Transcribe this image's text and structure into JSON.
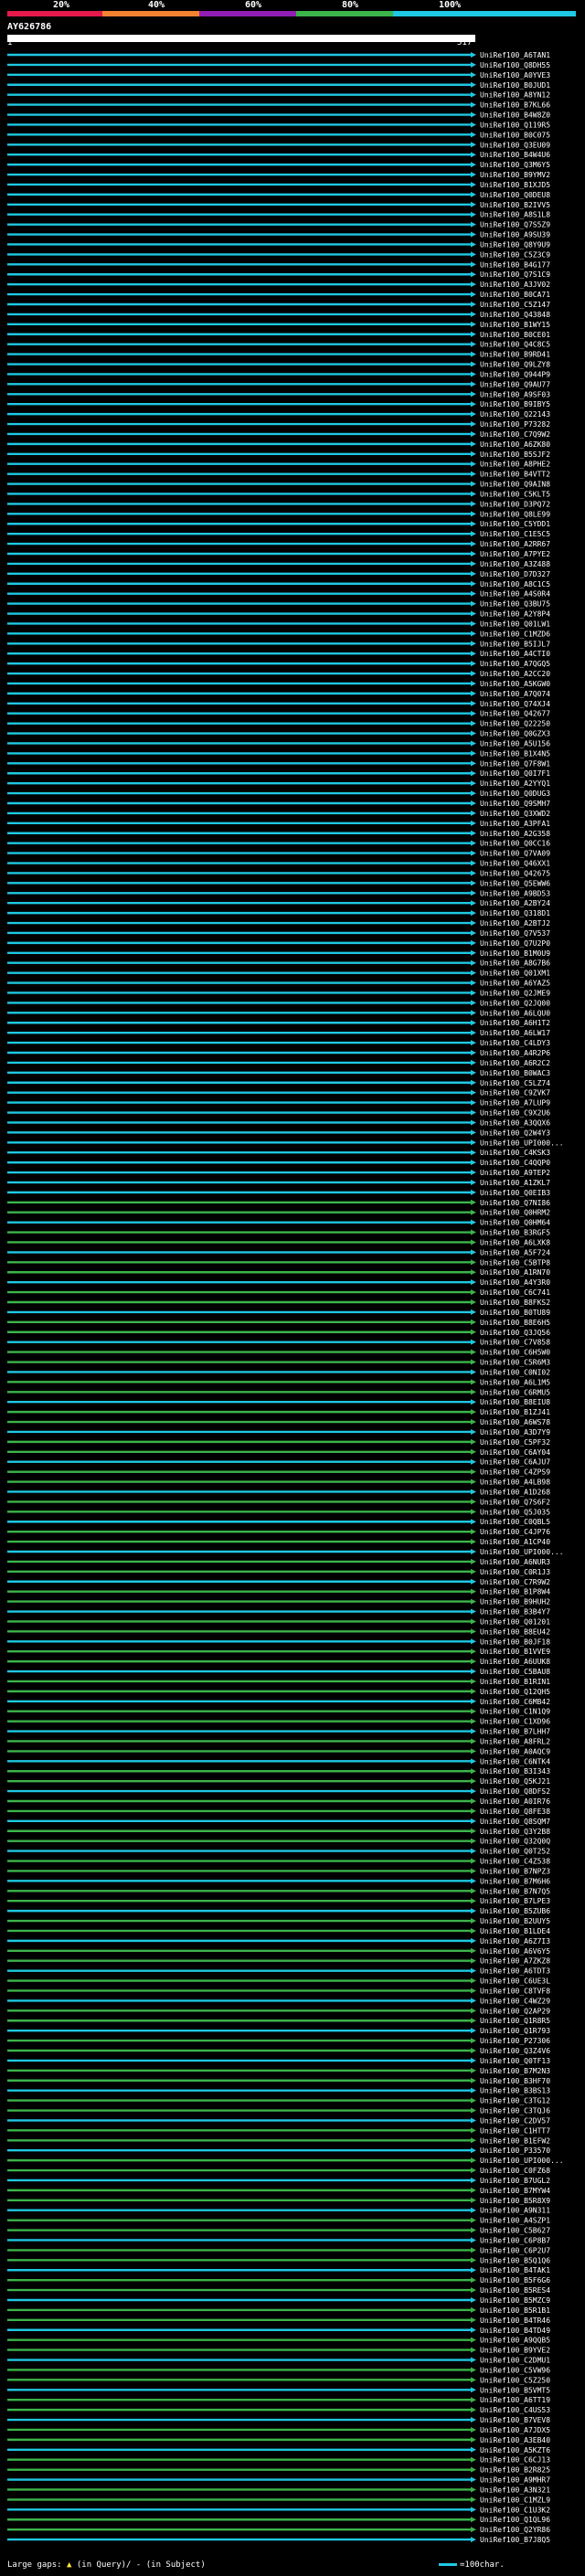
{
  "header": {
    "query_id": "AY626786",
    "query_start": "1",
    "query_end": "517",
    "percent_labels": [
      "20%",
      "40%",
      "60%",
      "80%",
      "100%"
    ],
    "band_colors": [
      "#e6194b",
      "#f58231",
      "#911eb4",
      "#3cb44b",
      "#1fc8e3"
    ]
  },
  "colors": {
    "background": "#000000",
    "hit_cyan": "#1fc8e3",
    "hit_green": "#3cb44b",
    "gap_marker": "#ffeb3b"
  },
  "hits": [
    "UniRef100_A6TAN1",
    "UniRef100_Q8DH55",
    "UniRef100_A0YVE3",
    "UniRef100_B0JUD1",
    "UniRef100_A8YN12",
    "UniRef100_B7KL66",
    "UniRef100_B4W8Z0",
    "UniRef100_Q119R5",
    "UniRef100_B0C075",
    "UniRef100_Q3EU09",
    "UniRef100_B4W4U6",
    "UniRef100_Q3M6Y5",
    "UniRef100_B9YMV2",
    "UniRef100_B1XJD5",
    "UniRef100_Q0DEU8",
    "UniRef100_B2IVV5",
    "UniRef100_A8S1L8",
    "UniRef100_Q7S5Z9",
    "UniRef100_A9SU39",
    "UniRef100_Q8Y9U9",
    "UniRef100_C5Z3C9",
    "UniRef100_B4G177",
    "UniRef100_Q7S1C9",
    "UniRef100_A3JV02",
    "UniRef100_B0CA71",
    "UniRef100_C5Z147",
    "UniRef100_Q43848",
    "UniRef100_B1WY15",
    "UniRef100_B0CE01",
    "UniRef100_Q4C8C5",
    "UniRef100_B9RD41",
    "UniRef100_Q9LZY8",
    "UniRef100_Q944P9",
    "UniRef100_Q9AU77",
    "UniRef100_A9SF03",
    "UniRef100_B9IBY5",
    "UniRef100_Q22143",
    "UniRef100_P73282",
    "UniRef100_C7Q9W2",
    "UniRef100_A6ZK80",
    "UniRef100_B5SJF2",
    "UniRef100_A8PHE2",
    "UniRef100_B4VTT2",
    "UniRef100_Q9AIN8",
    "UniRef100_C5KLT5",
    "UniRef100_D3PQ72",
    "UniRef100_Q8LE99",
    "UniRef100_C5YDD1",
    "UniRef100_C1E5C5",
    "UniRef100_A2RR67",
    "UniRef100_A7PYE2",
    "UniRef100_A3Z488",
    "UniRef100_D7D327",
    "UniRef100_A8C1C5",
    "UniRef100_A4S0R4",
    "UniRef100_Q3BU75",
    "UniRef100_A2Y8P4",
    "UniRef100_Q01LW1",
    "UniRef100_C1MZD6",
    "UniRef100_B5IJL7",
    "UniRef100_A4CTI0",
    "UniRef100_A7QGQ5",
    "UniRef100_A2CC20",
    "UniRef100_A5KGW0",
    "UniRef100_A7Q074",
    "UniRef100_Q74XJ4",
    "UniRef100_Q42677",
    "UniRef100_Q22250",
    "UniRef100_Q0GZX3",
    "UniRef100_A5U156",
    "UniRef100_B1X4N5",
    "UniRef100_Q7F8W1",
    "UniRef100_Q0I7F1",
    "UniRef100_A2YYQ1",
    "UniRef100_Q0DUG3",
    "UniRef100_Q9SMH7",
    "UniRef100_Q3XWD2",
    "UniRef100_A3PFA1",
    "UniRef100_A2G358",
    "UniRef100_Q0CC16",
    "UniRef100_Q7VA09",
    "UniRef100_Q46XX1",
    "UniRef100_Q42675",
    "UniRef100_Q5EWW6",
    "UniRef100_A9BD53",
    "UniRef100_A2BY24",
    "UniRef100_Q318D1",
    "UniRef100_A2BTJ2",
    "UniRef100_Q7V537",
    "UniRef100_Q7U2P0",
    "UniRef100_B1M0U9",
    "UniRef100_A8G7B6",
    "UniRef100_Q01XM1",
    "UniRef100_A6YAZ5",
    "UniRef100_Q2JME9",
    "UniRef100_Q2JQ00",
    "UniRef100_A6LQU0",
    "UniRef100_A6H1T2",
    "UniRef100_A6LW17",
    "UniRef100_C4LDY3",
    "UniRef100_A4R2P6",
    "UniRef100_A6R2C2",
    "UniRef100_B0WAC3",
    "UniRef100_C5LZ74",
    "UniRef100_C9ZVK7",
    "UniRef100_A7LUP9",
    "UniRef100_C9X2U6",
    "UniRef100_A3QQX6",
    "UniRef100_Q2W4Y3",
    "UniRef100_UPI000...",
    "UniRef100_C4KSK3",
    "UniRef100_C4QQP0",
    "UniRef100_A9TEP2",
    "UniRef100_A1ZKL7",
    "UniRef100_Q0EIB3",
    "UniRef100_Q7NI86",
    "UniRef100_Q0HRM2",
    "UniRef100_Q0HM64",
    "UniRef100_B3RGF5",
    "UniRef100_A6LXK8",
    "UniRef100_A5F724",
    "UniRef100_C5BTP8",
    "UniRef100_A1RN70",
    "UniRef100_A4Y3R0",
    "UniRef100_C6C741",
    "UniRef100_B8FKS2",
    "UniRef100_B0TU89",
    "UniRef100_B8E6H5",
    "UniRef100_Q3JQ56",
    "UniRef100_C7V858",
    "UniRef100_C6H5W0",
    "UniRef100_C5R6M3",
    "UniRef100_C0NI02",
    "UniRef100_A6L1M5",
    "UniRef100_C6RMU5",
    "UniRef100_B8EIU8",
    "UniRef100_B1ZJ41",
    "UniRef100_A6WS78",
    "UniRef100_A3D7Y9",
    "UniRef100_C5PF32",
    "UniRef100_C6AY04",
    "UniRef100_C6AJU7",
    "UniRef100_C4ZPS9",
    "UniRef100_A4LB98",
    "UniRef100_A1D268",
    "UniRef100_Q7S6F2",
    "UniRef100_Q5J035",
    "UniRef100_C0QBL5",
    "UniRef100_C4JP76",
    "UniRef100_A1CP40",
    "UniRef100_UPI000...",
    "UniRef100_A6NUR3",
    "UniRef100_C0R1J3",
    "UniRef100_C7R9W2",
    "UniRef100_B1P8W4",
    "UniRef100_B9HUH2",
    "UniRef100_B3B4Y7",
    "UniRef100_Q01201",
    "UniRef100_B8EU42",
    "UniRef100_B0JF18",
    "UniRef100_B1VVE9",
    "UniRef100_A6UUK8",
    "UniRef100_C5BAU8",
    "UniRef100_B1RIN1",
    "UniRef100_Q12QH5",
    "UniRef100_C6MB42",
    "UniRef100_C1N1Q9",
    "UniRef100_C1XD96",
    "UniRef100_B7LHH7",
    "UniRef100_A8FRL2",
    "UniRef100_A0AQC9",
    "UniRef100_C6NTK4",
    "UniRef100_B3I343",
    "UniRef100_Q5KJ21",
    "UniRef100_Q8DFS2",
    "UniRef100_A0IR76",
    "UniRef100_Q8FE38",
    "UniRef100_Q8SQM7",
    "UniRef100_Q3Y2B8",
    "UniRef100_Q32Q0Q",
    "UniRef100_Q0T252",
    "UniRef100_C4Z538",
    "UniRef100_B7NPZ3",
    "UniRef100_B7M6H6",
    "UniRef100_B7N7Q5",
    "UniRef100_B7LPE3",
    "UniRef100_B5ZUB6",
    "UniRef100_B2UUY5",
    "UniRef100_B1LDE4",
    "UniRef100_A6Z7I3",
    "UniRef100_A6V6Y5",
    "UniRef100_A7ZKZ8",
    "UniRef100_A6TDT3",
    "UniRef100_C6UE3L",
    "UniRef100_C8TVF8",
    "UniRef100_C4WZ29",
    "UniRef100_Q2AP29",
    "UniRef100_Q1R8R5",
    "UniRef100_Q1R793",
    "UniRef100_P27306",
    "UniRef100_Q3Z4V6",
    "UniRef100_Q0TF13",
    "UniRef100_B7M2N3",
    "UniRef100_B3HF70",
    "UniRef100_B3BS13",
    "UniRef100_C3TG12",
    "UniRef100_C3TQJ6",
    "UniRef100_C2DV57",
    "UniRef100_C1HTT7",
    "UniRef100_B1EFW2",
    "UniRef100_P33570",
    "UniRef100_UPI000...",
    "UniRef100_C0FZ68",
    "UniRef100_B7UGL2",
    "UniRef100_B7MYW4",
    "UniRef100_B5R8X9",
    "UniRef100_A9N311",
    "UniRef100_A4SZP1",
    "UniRef100_C5B627",
    "UniRef100_C6P8B7",
    "UniRef100_C6P2U7",
    "UniRef100_B5Q1Q6",
    "UniRef100_B4TAK1",
    "UniRef100_B5F6G6",
    "UniRef100_B5RES4",
    "UniRef100_B5MZC9",
    "UniRef100_B5R1B1",
    "UniRef100_B4TR46",
    "UniRef100_B4TD49",
    "UniRef100_A9QQB5",
    "UniRef100_B9YVE2",
    "UniRef100_C2DMU1",
    "UniRef100_C5VW96",
    "UniRef100_C5Z250",
    "UniRef100_B5VMT5",
    "UniRef100_A6TT19",
    "UniRef100_C4US53",
    "UniRef100_B7VEV8",
    "UniRef100_A7JDX5",
    "UniRef100_A3EB40",
    "UniRef100_A5KZT6",
    "UniRef100_C6CJ13",
    "UniRef100_B2R825",
    "UniRef100_A9MHR7",
    "UniRef100_A3N321",
    "UniRef100_C1MZL9",
    "UniRef100_C1U3K2",
    "UniRef100_Q1QL96",
    "UniRef100_Q2YR86",
    "UniRef100_B7J8Q5"
  ],
  "footer": {
    "gaps_label": "Large gaps:",
    "in_query": "(in Query)/",
    "in_subject": "- (in Subject)",
    "scale_label": "=100char."
  }
}
